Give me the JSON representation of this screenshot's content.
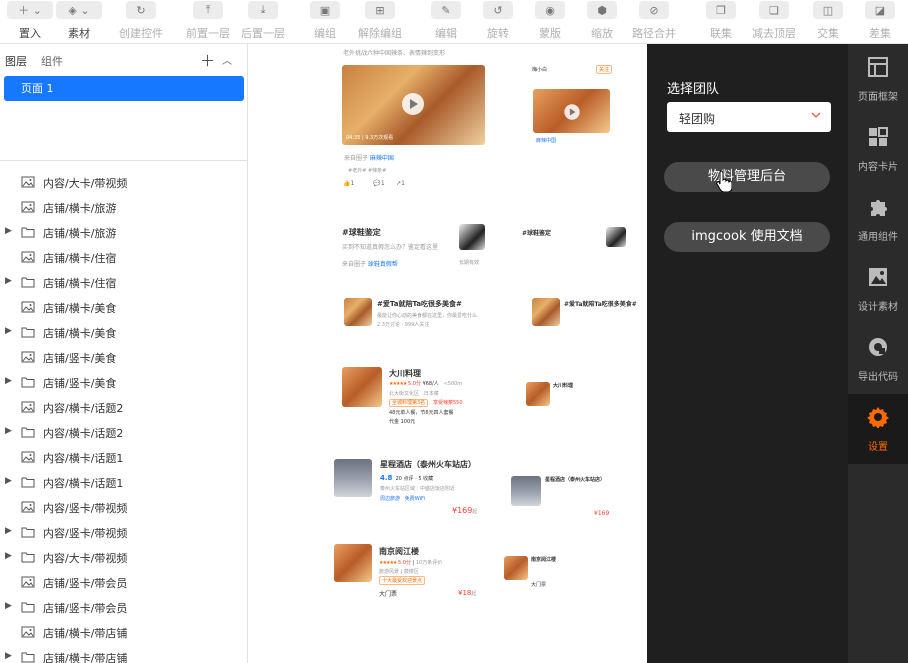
{
  "toolbar": {
    "items": [
      {
        "label": "置入",
        "icon": "plus-icon",
        "active": true
      },
      {
        "label": "素材",
        "icon": "layers-icon",
        "active": true
      },
      {
        "label": "创建控件",
        "icon": "refresh-icon",
        "active": false
      },
      {
        "label": "前置一层",
        "icon": "bring-forward-icon",
        "active": false
      },
      {
        "label": "后置一层",
        "icon": "send-backward-icon",
        "active": false
      },
      {
        "label": "编组",
        "icon": "group-icon",
        "active": false
      },
      {
        "label": "解除编组",
        "icon": "ungroup-icon",
        "active": false
      },
      {
        "label": "编辑",
        "icon": "edit-icon",
        "active": false
      },
      {
        "label": "旋转",
        "icon": "rotate-icon",
        "active": false
      },
      {
        "label": "蒙版",
        "icon": "mask-icon",
        "active": false
      },
      {
        "label": "缩放",
        "icon": "scale-icon",
        "active": false
      },
      {
        "label": "路径合并",
        "icon": "path-merge-icon",
        "active": false
      },
      {
        "label": "联集",
        "icon": "union-icon",
        "active": false
      },
      {
        "label": "减去顶层",
        "icon": "subtract-icon",
        "active": false
      },
      {
        "label": "交集",
        "icon": "intersect-icon",
        "active": false
      },
      {
        "label": "差集",
        "icon": "difference-icon",
        "active": false
      }
    ]
  },
  "left_panel": {
    "tabs": {
      "layers": "图层",
      "components": "组件"
    },
    "page": "页面 1",
    "layers": [
      {
        "label": "内容/大卡/带视频",
        "type": "image",
        "expandable": false
      },
      {
        "label": "店铺/横卡/旅游",
        "type": "image",
        "expandable": false
      },
      {
        "label": "店铺/横卡/旅游",
        "type": "folder",
        "expandable": true
      },
      {
        "label": "店铺/横卡/住宿",
        "type": "image",
        "expandable": false
      },
      {
        "label": "店铺/横卡/住宿",
        "type": "folder",
        "expandable": true
      },
      {
        "label": "店铺/横卡/美食",
        "type": "image",
        "expandable": false
      },
      {
        "label": "店铺/横卡/美食",
        "type": "folder",
        "expandable": true
      },
      {
        "label": "店铺/竖卡/美食",
        "type": "image",
        "expandable": false
      },
      {
        "label": "店铺/竖卡/美食",
        "type": "folder",
        "expandable": true
      },
      {
        "label": "内容/横卡/话题2",
        "type": "image",
        "expandable": false
      },
      {
        "label": "内容/横卡/话题2",
        "type": "folder",
        "expandable": true
      },
      {
        "label": "内容/横卡/话题1",
        "type": "image",
        "expandable": false
      },
      {
        "label": "内容/横卡/话题1",
        "type": "folder",
        "expandable": true
      },
      {
        "label": "内容/竖卡/带视频",
        "type": "image",
        "expandable": false
      },
      {
        "label": "内容/竖卡/带视频",
        "type": "folder",
        "expandable": true
      },
      {
        "label": "内容/大卡/带视频",
        "type": "folder",
        "expandable": true
      },
      {
        "label": "店铺/竖卡/带会员",
        "type": "image",
        "expandable": false
      },
      {
        "label": "店铺/竖卡/带会员",
        "type": "folder",
        "expandable": true
      },
      {
        "label": "店铺/横卡/带店铺",
        "type": "image",
        "expandable": false
      },
      {
        "label": "店铺/横卡/带店铺",
        "type": "folder",
        "expandable": true
      }
    ]
  },
  "canvas": {
    "top_caption": "老外挑战六种中国辣条、表情辣到变形",
    "video_card": {
      "meta": "04:35 | 9.3万次观看",
      "circle_prefix": "来自圈子 ",
      "circle": "麻辣中国",
      "tag": "#老外#",
      "tag2": "#辣条#",
      "likes": "1",
      "comments": "1",
      "shares": "1"
    },
    "video_card_small": {
      "author": "梅小白",
      "badge": "关注",
      "circle": "麻辣中国"
    },
    "topic1": {
      "title": "#球鞋鉴定",
      "desc": "买到不知道真假怎么办？鉴定看这里",
      "circle_prefix": "来自圈子 ",
      "circle": "球鞋真假帮",
      "right": "长期有效"
    },
    "topic2": {
      "title": "#爱Ta就陪Ta吃很多美食#",
      "desc": "最能让你心动的美食都在这里，你最爱吃什么",
      "meta": "2.3万讨论 · 999人关注"
    },
    "food": {
      "name": "大川料理",
      "score": "5.0分",
      "price_per": "¥68/人",
      "distance": "<500m",
      "area": "北大街文化区",
      "cuisine": "日本菜",
      "promo": "全城料理第3名",
      "promo2": "享受辣菜550",
      "deal1": "48元单人餐，节6元四人套餐",
      "deal2": "代金 100元"
    },
    "hotel": {
      "name": "星程酒店（泰州火车站店）",
      "rating": "4.8",
      "reviews": "20 点评 · 5 收藏",
      "location": "泰州火车站区域｜中盛店饭店附近",
      "tag1": "周边旅游",
      "tag2": "免费WiFi",
      "price": "¥169",
      "price_suffix": "起"
    },
    "pavilion": {
      "name": "南京阅江楼",
      "score": "5.0分",
      "reviews": "10万条评价",
      "area": "旅游风景",
      "district": "鼓楼区",
      "badge": "十大最受欢迎景点",
      "ticket": "大门票",
      "price": "¥18",
      "price_suffix": "起"
    }
  },
  "right_panel": {
    "select_team_label": "选择团队",
    "team_value": "轻团购",
    "btn_admin": "物料管理后台",
    "btn_docs": "imgcook 使用文档"
  },
  "right_nav": [
    {
      "label": "页面框架",
      "icon": "page-frame-icon",
      "active": false
    },
    {
      "label": "内容卡片",
      "icon": "content-card-icon",
      "active": false
    },
    {
      "label": "通用组件",
      "icon": "puzzle-icon",
      "active": false
    },
    {
      "label": "设计素材",
      "icon": "image-icon",
      "active": false
    },
    {
      "label": "导出代码",
      "icon": "export-icon",
      "active": false
    },
    {
      "label": "设置",
      "icon": "settings-gear-icon",
      "active": true
    }
  ],
  "colors": {
    "accent": "#1677ff",
    "orange": "#ff6a00",
    "dark_panel": "#1f1f1f",
    "nav_bg": "#2b2b2b"
  }
}
